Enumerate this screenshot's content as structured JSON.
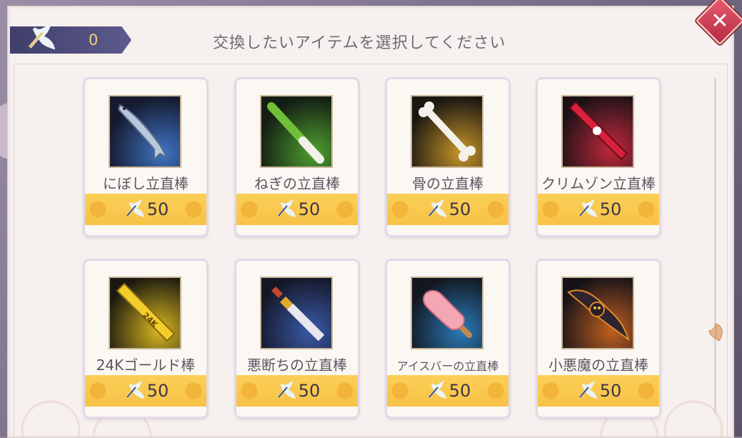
{
  "header": {
    "currency_icon": "feather-sword-icon",
    "currency_count": "0",
    "title": "交換したいアイテムを選択してください",
    "close_icon": "close-icon"
  },
  "items": [
    {
      "name": "にぼし立直棒",
      "price": "50",
      "icon": "dried-fish-stick-icon",
      "accent": "#3f74c4"
    },
    {
      "name": "ねぎの立直棒",
      "price": "50",
      "icon": "green-onion-stick-icon",
      "accent": "#4ea030"
    },
    {
      "name": "骨の立直棒",
      "price": "50",
      "icon": "bone-stick-icon",
      "accent": "#c8962a"
    },
    {
      "name": "クリムゾン立直棒",
      "price": "50",
      "icon": "crimson-stick-icon",
      "accent": "#c0283c"
    },
    {
      "name": "24Kゴールド棒",
      "price": "50",
      "icon": "gold-bar-stick-icon",
      "accent": "#d8b820"
    },
    {
      "name": "悪断ちの立直棒",
      "price": "50",
      "icon": "pixel-sword-stick-icon",
      "accent": "#3a5aa8"
    },
    {
      "name": "アイスバーの立直棒",
      "price": "50",
      "icon": "ice-pop-stick-icon",
      "accent": "#2a7ab8"
    },
    {
      "name": "小悪魔の立直棒",
      "price": "50",
      "icon": "little-devil-stick-icon",
      "accent": "#c06020"
    }
  ],
  "colors": {
    "panel": "#f6f0ee",
    "price_bar": "#f7c247",
    "close": "#d0405a",
    "badge": "#4a4878"
  }
}
